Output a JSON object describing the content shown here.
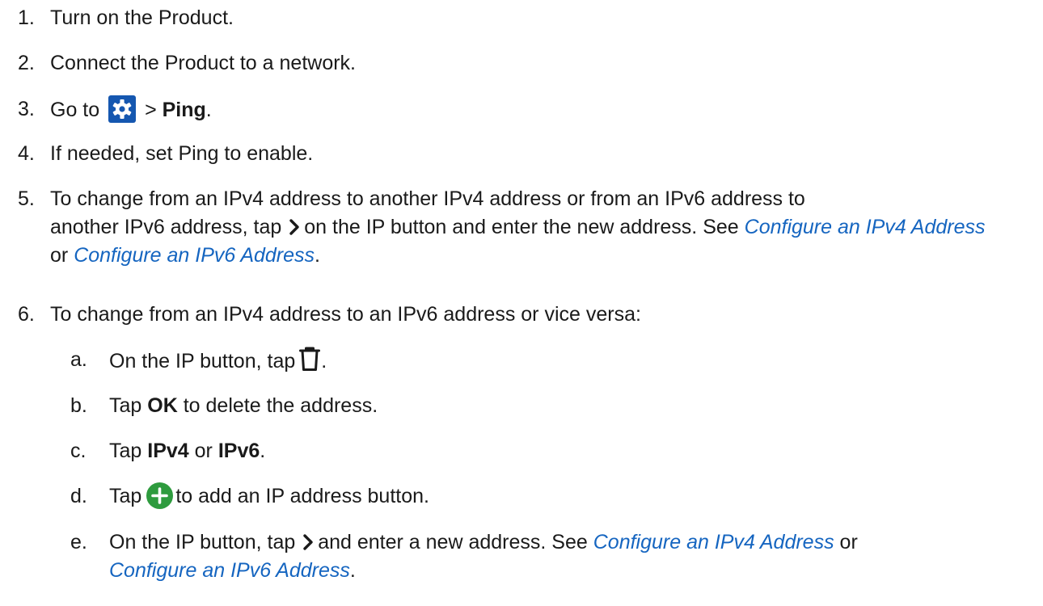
{
  "steps": [
    {
      "num": "1.",
      "text": "Turn on the Product."
    },
    {
      "num": "2.",
      "text": "Connect the Product to a network."
    },
    {
      "num": "3.",
      "pre": "Go to",
      "mid": ">",
      "bold": "Ping",
      "post": "."
    },
    {
      "num": "4.",
      "text": "If needed, set Ping to enable."
    },
    {
      "num": "5.",
      "line1": "To change from an IPv4 address to another IPv4 address or from an IPv6 address to",
      "line2_pre": "another IPv6 address, tap",
      "line2_post": "on the IP button and enter the new address. See",
      "link1": "Configure an IPv4 Address",
      "or": "or",
      "link2": "Configure an IPv6 Address",
      "end": "."
    },
    {
      "num": "6.",
      "text": "To change from an IPv4 address to an IPv6 address or vice versa:"
    }
  ],
  "substeps": [
    {
      "num": "a.",
      "pre": "On the IP button, tap",
      "post": "."
    },
    {
      "num": "b.",
      "pre": "Tap",
      "bold": "OK",
      "post": "to delete the address."
    },
    {
      "num": "c.",
      "pre": "Tap",
      "bold1": "IPv4",
      "or": "or",
      "bold2": "IPv6",
      "post": "."
    },
    {
      "num": "d.",
      "pre": "Tap",
      "post": "to add an IP address button."
    },
    {
      "num": "e.",
      "pre": "On the IP button, tap",
      "post": "and enter a new address. See",
      "link1": "Configure an IPv4 Address",
      "or": "or",
      "link2": "Configure an IPv6 Address",
      "end": "."
    }
  ],
  "icons": {
    "gear": "settings-gear",
    "chevron": "chevron-right",
    "trash": "trash-can",
    "plus": "add-plus"
  },
  "colors": {
    "link": "#1565c0",
    "gear_bg": "#1557b0",
    "plus_bg": "#2e9b3e",
    "text": "#1a1a1a"
  }
}
